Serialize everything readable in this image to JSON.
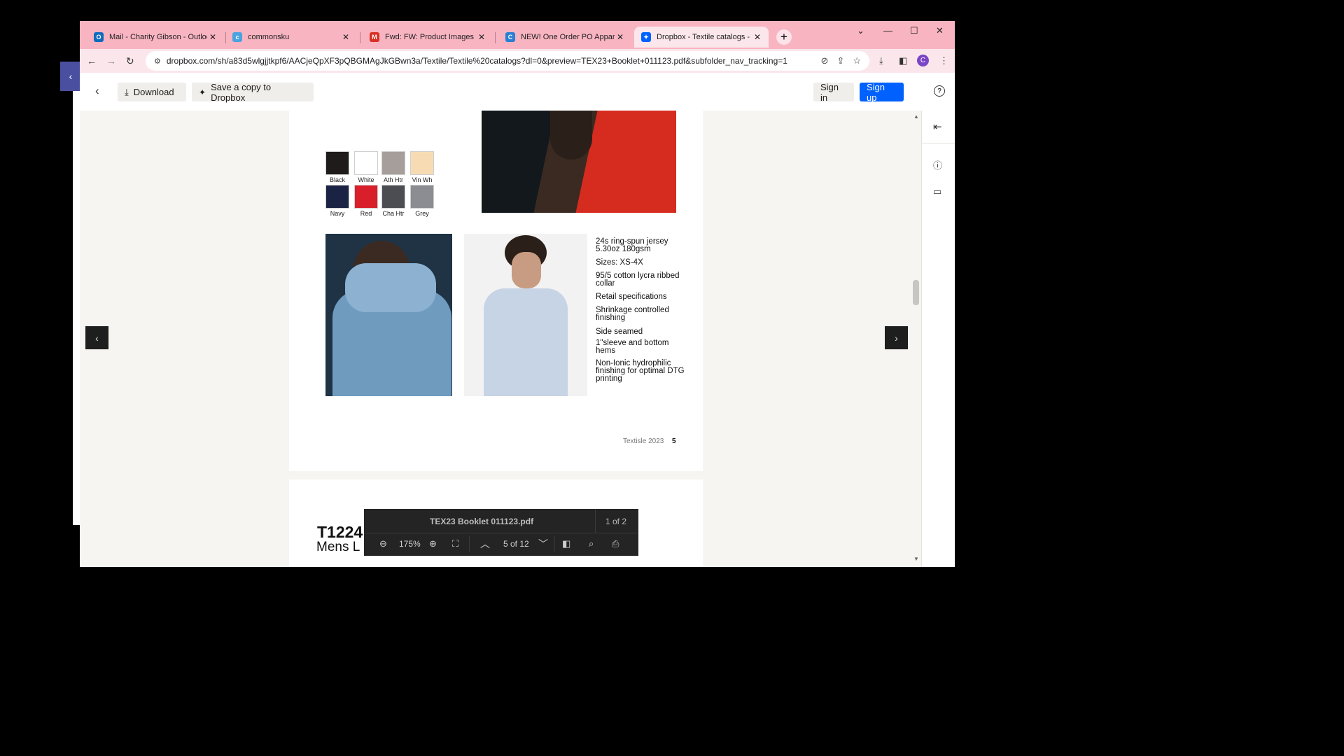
{
  "browser": {
    "tabs": [
      {
        "title": "Mail - Charity Gibson - Outlook",
        "icon": "outlook-icon",
        "icon_letter": "O",
        "icon_color": "#0f6cbd"
      },
      {
        "title": "commonsku",
        "icon": "commonsku-icon",
        "icon_letter": "c",
        "icon_color": "#4aa3df"
      },
      {
        "title": "Fwd: FW: Product Images and M",
        "icon": "gmail-icon",
        "icon_letter": "M",
        "icon_color": "#d93025"
      },
      {
        "title": "NEW! One Order PO Apparel Fi",
        "icon": "commonsku-c-icon",
        "icon_letter": "C",
        "icon_color": "#2a7fd4"
      },
      {
        "title": "Dropbox - Textile catalogs - Si",
        "icon": "dropbox-icon",
        "icon_letter": "✦",
        "icon_color": "#0061fe"
      }
    ],
    "new_tab": "+",
    "url": "dropbox.com/sh/a83d5wlgjjtkpf6/AACjeQpXF3pQBGMAgJkGBwn3a/Textile/Textile%20catalogs?dl=0&preview=TEX23+Booklet+011123.pdf&subfolder_nav_tracking=1",
    "avatar_letter": "C"
  },
  "dropbox_header": {
    "download_label": "Download",
    "save_label": "Save a copy to Dropbox",
    "sign_in_label": "Sign in",
    "sign_up_label": "Sign up"
  },
  "swatches": [
    {
      "name": "Black",
      "color": "#1f1b1b"
    },
    {
      "name": "White",
      "color": "#ffffff"
    },
    {
      "name": "Ath Htr",
      "color": "#a59e9a"
    },
    {
      "name": "Vin Wh",
      "color": "#f7dcb3"
    },
    {
      "name": "Navy",
      "color": "#1a2344"
    },
    {
      "name": "Red",
      "color": "#d81f2a"
    },
    {
      "name": "Cha Htr",
      "color": "#4b4d52"
    },
    {
      "name": "Grey",
      "color": "#8b8d92"
    }
  ],
  "specs": [
    "24s ring-spun jersey 5.30oz 180gsm",
    "Sizes: XS-4X",
    "95/5 cotton lycra ribbed collar",
    "Retail specifications",
    "Shrinkage controlled finishing",
    "Side seamed",
    "1\"sleeve and bottom hems",
    "Non-Ionic hydrophilic finishing for optimal DTG printing"
  ],
  "page_footer": {
    "brand": "Textisle 2023",
    "page": "5"
  },
  "next_page": {
    "product_code": "T1224",
    "product_name": "Mens L"
  },
  "toolbar": {
    "filename": "TEX23 Booklet 011123.pdf",
    "file_count": "1 of 2",
    "zoom": "175%",
    "page_indicator": "5 of 12"
  }
}
